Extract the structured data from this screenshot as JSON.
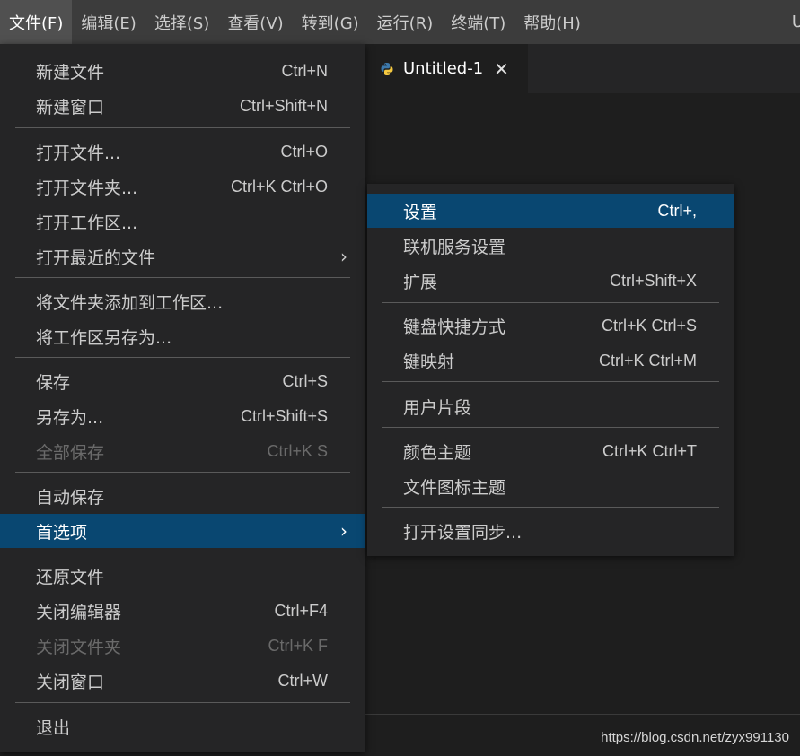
{
  "menubar": {
    "items": [
      "文件(F)",
      "编辑(E)",
      "选择(S)",
      "查看(V)",
      "转到(G)",
      "运行(R)",
      "终端(T)",
      "帮助(H)"
    ],
    "overflow": "U"
  },
  "tab": {
    "label": "Untitled-1",
    "close": "✕",
    "icon": "python-icon"
  },
  "file_menu": {
    "items": [
      {
        "label": "新建文件",
        "shortcut": "Ctrl+N"
      },
      {
        "label": "新建窗口",
        "shortcut": "Ctrl+Shift+N"
      },
      {
        "label": "打开文件...",
        "shortcut": "Ctrl+O"
      },
      {
        "label": "打开文件夹...",
        "shortcut": "Ctrl+K Ctrl+O"
      },
      {
        "label": "打开工作区...",
        "shortcut": ""
      },
      {
        "label": "打开最近的文件",
        "shortcut": "",
        "submenu": true
      },
      {
        "label": "将文件夹添加到工作区...",
        "shortcut": ""
      },
      {
        "label": "将工作区另存为...",
        "shortcut": ""
      },
      {
        "label": "保存",
        "shortcut": "Ctrl+S"
      },
      {
        "label": "另存为...",
        "shortcut": "Ctrl+Shift+S"
      },
      {
        "label": "全部保存",
        "shortcut": "Ctrl+K S",
        "disabled": true
      },
      {
        "label": "自动保存",
        "shortcut": ""
      },
      {
        "label": "首选项",
        "shortcut": "",
        "submenu": true,
        "selected": true
      },
      {
        "label": "还原文件",
        "shortcut": ""
      },
      {
        "label": "关闭编辑器",
        "shortcut": "Ctrl+F4"
      },
      {
        "label": "关闭文件夹",
        "shortcut": "Ctrl+K F",
        "disabled": true
      },
      {
        "label": "关闭窗口",
        "shortcut": "Ctrl+W"
      },
      {
        "label": "退出",
        "shortcut": ""
      }
    ],
    "submenu_arrow": "›"
  },
  "pref_menu": {
    "items": [
      {
        "label": "设置",
        "shortcut": "Ctrl+,",
        "selected": true
      },
      {
        "label": "联机服务设置",
        "shortcut": ""
      },
      {
        "label": "扩展",
        "shortcut": "Ctrl+Shift+X"
      },
      {
        "label": "键盘快捷方式",
        "shortcut": "Ctrl+K Ctrl+S"
      },
      {
        "label": "键映射",
        "shortcut": "Ctrl+K Ctrl+M"
      },
      {
        "label": "用户片段",
        "shortcut": ""
      },
      {
        "label": "颜色主题",
        "shortcut": "Ctrl+K Ctrl+T"
      },
      {
        "label": "文件图标主题",
        "shortcut": ""
      },
      {
        "label": "打开设置同步...",
        "shortcut": ""
      }
    ]
  },
  "watermark": "https://blog.csdn.net/zyx991130",
  "colors": {
    "selection": "#094771",
    "menu_bg": "#252526",
    "menubar_bg": "#3c3c3c"
  }
}
